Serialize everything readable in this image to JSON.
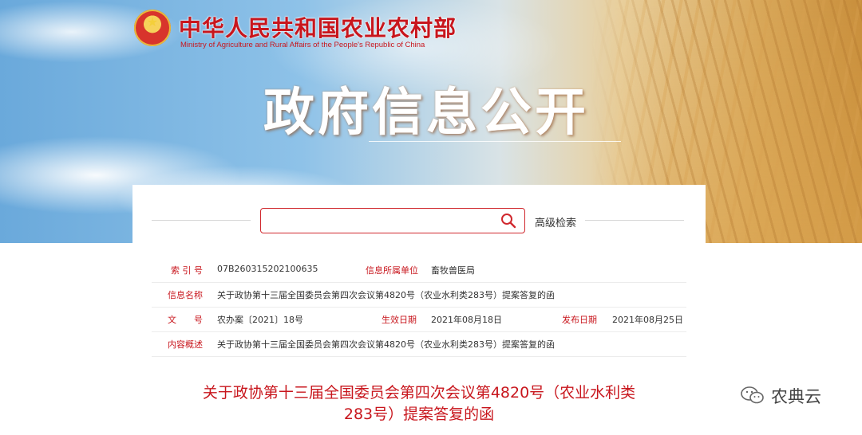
{
  "header": {
    "ministry_cn": "中华人民共和国农业农村部",
    "ministry_en": "Ministry of Agriculture and Rural Affairs of the People's Republic of China",
    "portal_title": "政府信息公开"
  },
  "search": {
    "value": "",
    "placeholder": "",
    "advanced_label": "高级检索"
  },
  "info": {
    "index_label": "索 引 号",
    "index_value": "07B260315202100635",
    "org_label": "信息所属单位",
    "org_value": "畜牧兽医局",
    "name_label": "信息名称",
    "name_value": "关于政协第十三届全国委员会第四次会议第4820号（农业水利类283号）提案答复的函",
    "doc_label": "文　　号",
    "doc_value": "农办案〔2021〕18号",
    "effective_label": "生效日期",
    "effective_value": "2021年08月18日",
    "publish_label": "发布日期",
    "publish_value": "2021年08月25日",
    "summary_label": "内容概述",
    "summary_value": "关于政协第十三届全国委员会第四次会议第4820号（农业水利类283号）提案答复的函"
  },
  "article": {
    "title_line1": "关于政协第十三届全国委员会第四次会议第4820号（农业水利类",
    "title_line2": "283号）提案答复的函"
  },
  "watermark": {
    "text": "农典云"
  },
  "colors": {
    "accent_red": "#c8161d",
    "border_red": "#d0282e"
  }
}
